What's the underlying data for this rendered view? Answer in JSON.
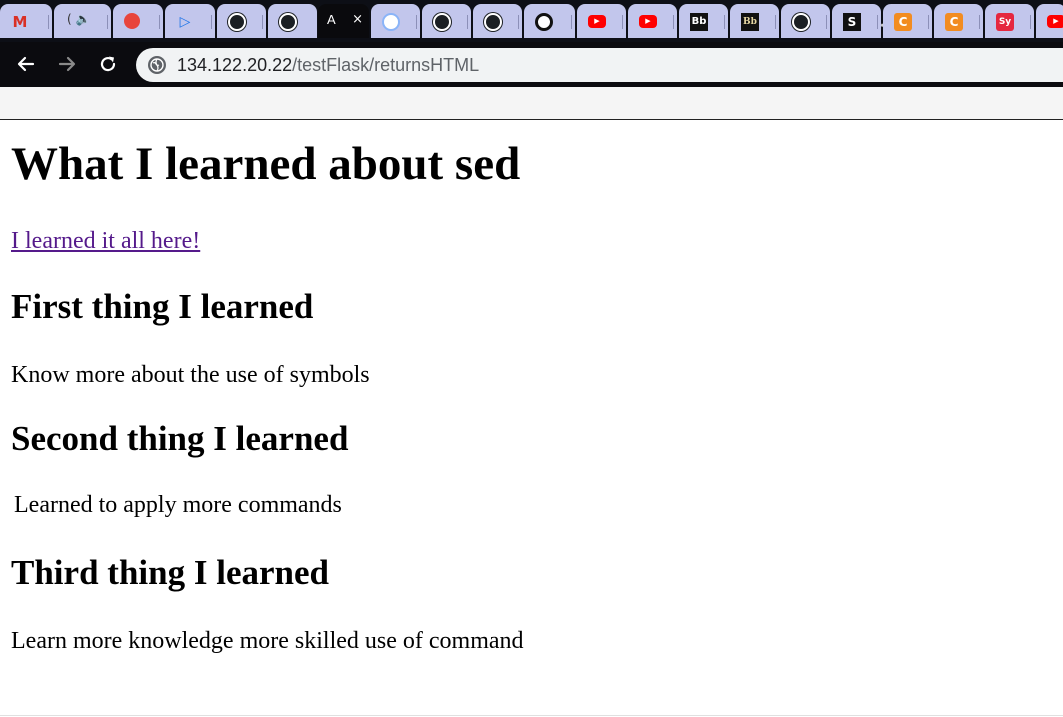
{
  "browser": {
    "active_tab_title": "A",
    "close_glyph": "×",
    "address": {
      "host": "134.122.20.22",
      "path": "/testFlask/returnsHTML"
    },
    "tabs": [
      {
        "icon": "gmail-icon",
        "glyph": "M"
      },
      {
        "icon": "speaker-icon",
        "glyph": "(  🔈"
      },
      {
        "icon": "fire-icon",
        "glyph": ""
      },
      {
        "icon": "play-icon",
        "glyph": "▷"
      },
      {
        "icon": "github-icon",
        "glyph": ""
      },
      {
        "icon": "github-icon",
        "glyph": ""
      },
      {
        "icon": "active",
        "glyph": ""
      },
      {
        "icon": "globe-icon",
        "glyph": ""
      },
      {
        "icon": "github-icon",
        "glyph": ""
      },
      {
        "icon": "github-icon",
        "glyph": ""
      },
      {
        "icon": "target-icon",
        "glyph": ""
      },
      {
        "icon": "youtube-icon",
        "glyph": "▶"
      },
      {
        "icon": "youtube-icon",
        "glyph": "▶"
      },
      {
        "icon": "blackboard-icon",
        "glyph": "Bb"
      },
      {
        "icon": "blackboard-icon",
        "glyph": "Bb"
      },
      {
        "icon": "github-icon",
        "glyph": ""
      },
      {
        "icon": "s-icon",
        "glyph": "S"
      },
      {
        "icon": "c-icon",
        "glyph": "C"
      },
      {
        "icon": "c-icon",
        "glyph": "C"
      },
      {
        "icon": "sy-icon",
        "glyph": "Sy"
      },
      {
        "icon": "youtube-icon",
        "glyph": "▶"
      }
    ]
  },
  "page": {
    "heading": "What I learned about sed",
    "link_text": "I learned it all here!",
    "sections": [
      {
        "heading": "First thing I learned",
        "text": "Know more about the use of symbols"
      },
      {
        "heading": "Second thing I learned",
        "text": "Learned to apply more commands"
      },
      {
        "heading": "Third thing I learned",
        "text": "Learn more knowledge more skilled use of command"
      }
    ]
  },
  "colors": {
    "link_visited": "#551a8b",
    "tab_inactive": "#c2c6ec",
    "tab_active": "#0a0a0d"
  }
}
